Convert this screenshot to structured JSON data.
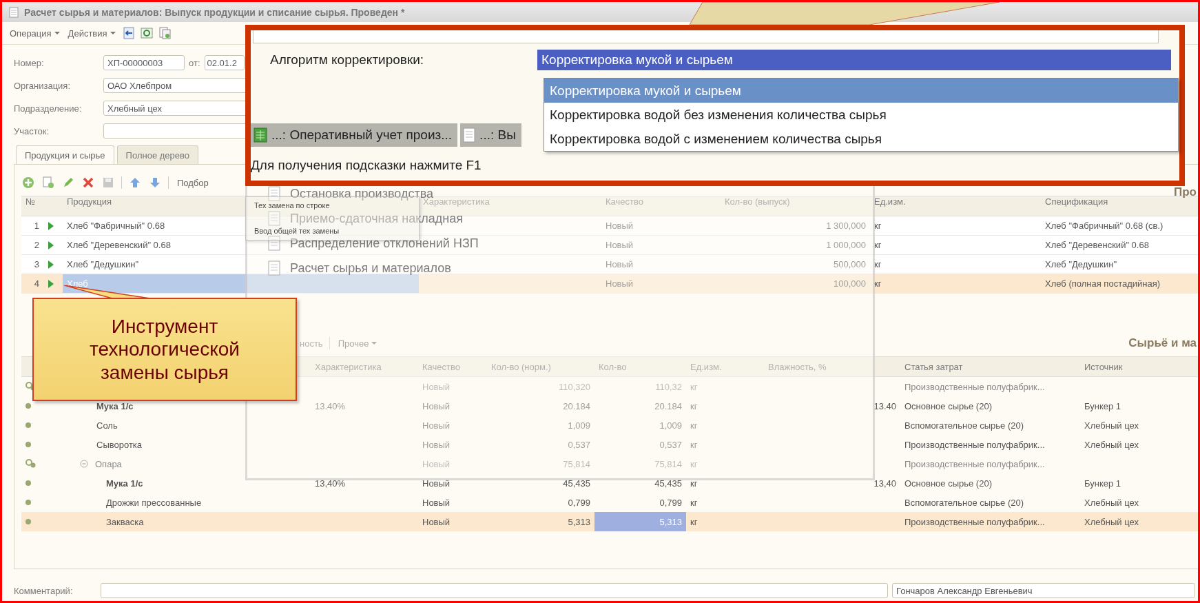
{
  "window": {
    "title": "Расчет сырья и материалов: Выпуск продукции и списание сырья. Проведен *"
  },
  "menu": [
    {
      "label": "Операция",
      "kind": "dropdown"
    },
    {
      "label": "Действия",
      "kind": "dropdown"
    }
  ],
  "fields": {
    "number_label": "Номер:",
    "number": "ХП-00000003",
    "date_label": "от:",
    "date": "02.01.2",
    "organization_label": "Организация:",
    "organization": "ОАО Хлебпром",
    "department_label": "Подразделение:",
    "department": "Хлебный цех",
    "section_label": "Участок:"
  },
  "tabs": [
    {
      "label": "Продукция и сырье",
      "selected": true
    },
    {
      "label": "Полное дерево",
      "selected": false
    }
  ],
  "products": {
    "toolbar_button": "Подбор",
    "title": "Про",
    "columns": [
      "№",
      "Продукция",
      "Характеристика",
      "Качество",
      "Кол-во (выпуск)",
      "Ед.изм.",
      "Спецификация"
    ],
    "rows": [
      {
        "number": "1",
        "name": "Хлеб \"Фабричный\" 0.68",
        "quality": "Новый",
        "quantity": "1 300,000",
        "unit": "кг",
        "specification": "Хлеб \"Фабричный\" 0.68 (св.)",
        "selected": false
      },
      {
        "number": "2",
        "name": "Хлеб \"Деревенский\" 0.68",
        "quality": "Новый",
        "quantity": "1 000,000",
        "unit": "кг",
        "specification": "Хлеб \"Деревенский\" 0.68",
        "selected": false
      },
      {
        "number": "3",
        "name": "Хлеб \"Дедушкин\"",
        "quality": "Новый",
        "quantity": "500,000",
        "unit": "кг",
        "specification": "Хлеб \"Дедушкин\"",
        "selected": false
      },
      {
        "number": "4",
        "name": "Хлеб",
        "quality": "Новый",
        "quantity": "100,000",
        "unit": "кг",
        "specification": "Хлеб (полная постадийная)",
        "selected": true
      }
    ]
  },
  "materials": {
    "title": "Сырьё и ма",
    "toolbar": [
      "ность",
      "Прочее"
    ],
    "columns": [
      "Характеристика",
      "Качество",
      "Кол-во (норм.)",
      "Кол-во",
      "Ед.изм.",
      "Влажность, %",
      "Статья затрат",
      "Источник"
    ],
    "rows": [
      {
        "kind": "group",
        "quality": "Новый",
        "norm": "110,320",
        "quantity": "110,32",
        "unit": "кг",
        "cost_item": "Производственные полуфабрик...",
        "selected": false,
        "children": [
          {
            "kind": "item",
            "name": "Мука 1/с",
            "bold": true,
            "characteristic": "13.40%",
            "quality": "Новый",
            "norm": "20.184",
            "quantity": "20.184",
            "unit": "кг",
            "humidity": "13.40",
            "cost_item": "Основное сырье (20)",
            "source": "Бункер 1",
            "selected": false
          },
          {
            "kind": "item",
            "name": "Соль",
            "bold": false,
            "quality": "Новый",
            "norm": "1,009",
            "quantity": "1,009",
            "unit": "кг",
            "cost_item": "Вспомогательное сырье (20)",
            "source": "Хлебный цех",
            "selected": false
          },
          {
            "kind": "item",
            "name": "Сыворотка",
            "bold": false,
            "quality": "Новый",
            "norm": "0,537",
            "quantity": "0,537",
            "unit": "кг",
            "cost_item": "Производственные полуфабрик...",
            "source": "Хлебный цех",
            "selected": false
          },
          {
            "kind": "group",
            "name": "Опара",
            "expanded": true,
            "quality": "Новый",
            "norm": "75,814",
            "quantity": "75,814",
            "unit": "кг",
            "cost_item": "Производственные полуфабрик...",
            "selected": false,
            "children": [
              {
                "kind": "item",
                "name": "Мука 1/с",
                "bold": true,
                "characteristic": "13,40%",
                "quality": "Новый",
                "norm": "45,435",
                "quantity": "45,435",
                "unit": "кг",
                "humidity": "13,40",
                "cost_item": "Основное сырье (20)",
                "source": "Бункер 1",
                "selected": false
              },
              {
                "kind": "item",
                "name": "Дрожжи прессованные",
                "bold": false,
                "quality": "Новый",
                "norm": "0,799",
                "quantity": "0,799",
                "unit": "кг",
                "cost_item": "Вспомогательное сырье (20)",
                "source": "Хлебный цех",
                "selected": false
              },
              {
                "kind": "item",
                "name": "Закваска",
                "bold": false,
                "quality": "Новый",
                "norm": "5,313",
                "quantity": "5,313",
                "unit": "кг",
                "cost_item": "Производственные полуфабрик...",
                "source": "Хлебный цех",
                "selected": true
              }
            ]
          }
        ]
      }
    ]
  },
  "comment": {
    "label": "Комментарий:",
    "author": "Гончаров Александр Евгеньевич"
  },
  "journal": {
    "items": [
      "Остановка производства",
      "Приемо-сдаточная накладная",
      "Распределение отклонений НЗП",
      "Расчет сырья и материалов"
    ]
  },
  "context_menu": {
    "items": [
      "Тех замена по строке",
      "Ввод общей тех замены"
    ]
  },
  "inset": {
    "label": "Алгоритм корректировки:",
    "value": "Корректировка мукой и сырьем",
    "options": [
      {
        "label": "Корректировка мукой и сырьем",
        "selected": true
      },
      {
        "label": "Корректировка водой без изменения количества сырья",
        "selected": false
      },
      {
        "label": "Корректировка водой с изменением количества сырья",
        "selected": false
      }
    ],
    "windows": [
      {
        "label": "...: Оперативный учет произ...",
        "kind": "sheet"
      },
      {
        "label": "...: Вы",
        "kind": "document"
      }
    ],
    "status": "Для получения подсказки нажмите F1"
  },
  "callout": {
    "lines": [
      "Инструмент",
      "технологической",
      "замены сырья"
    ]
  }
}
